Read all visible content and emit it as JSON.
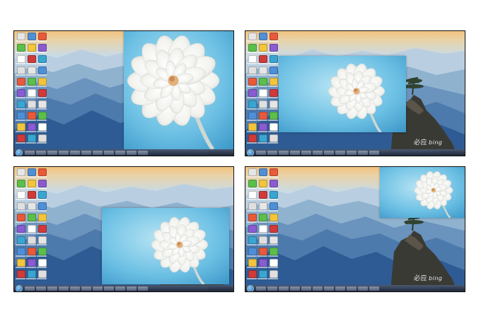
{
  "watermark": {
    "cn": "必应",
    "en": "bing"
  },
  "colors": {
    "sky_top": "#f3c27f",
    "sky_mid": "#c9dbe6",
    "mountain_far": "#8fb2cf",
    "mountain_mid": "#5d86b4",
    "mountain_near": "#2e5b93",
    "photo_bg": "#5fb8e0",
    "taskbar": "#2b3850"
  },
  "panels": [
    {
      "id": "p1",
      "photo_state": "right-half"
    },
    {
      "id": "p2",
      "photo_state": "centered"
    },
    {
      "id": "p3",
      "photo_state": "lower-right"
    },
    {
      "id": "p4",
      "photo_state": "top-right-small"
    }
  ],
  "desktop_icon_count": 30
}
